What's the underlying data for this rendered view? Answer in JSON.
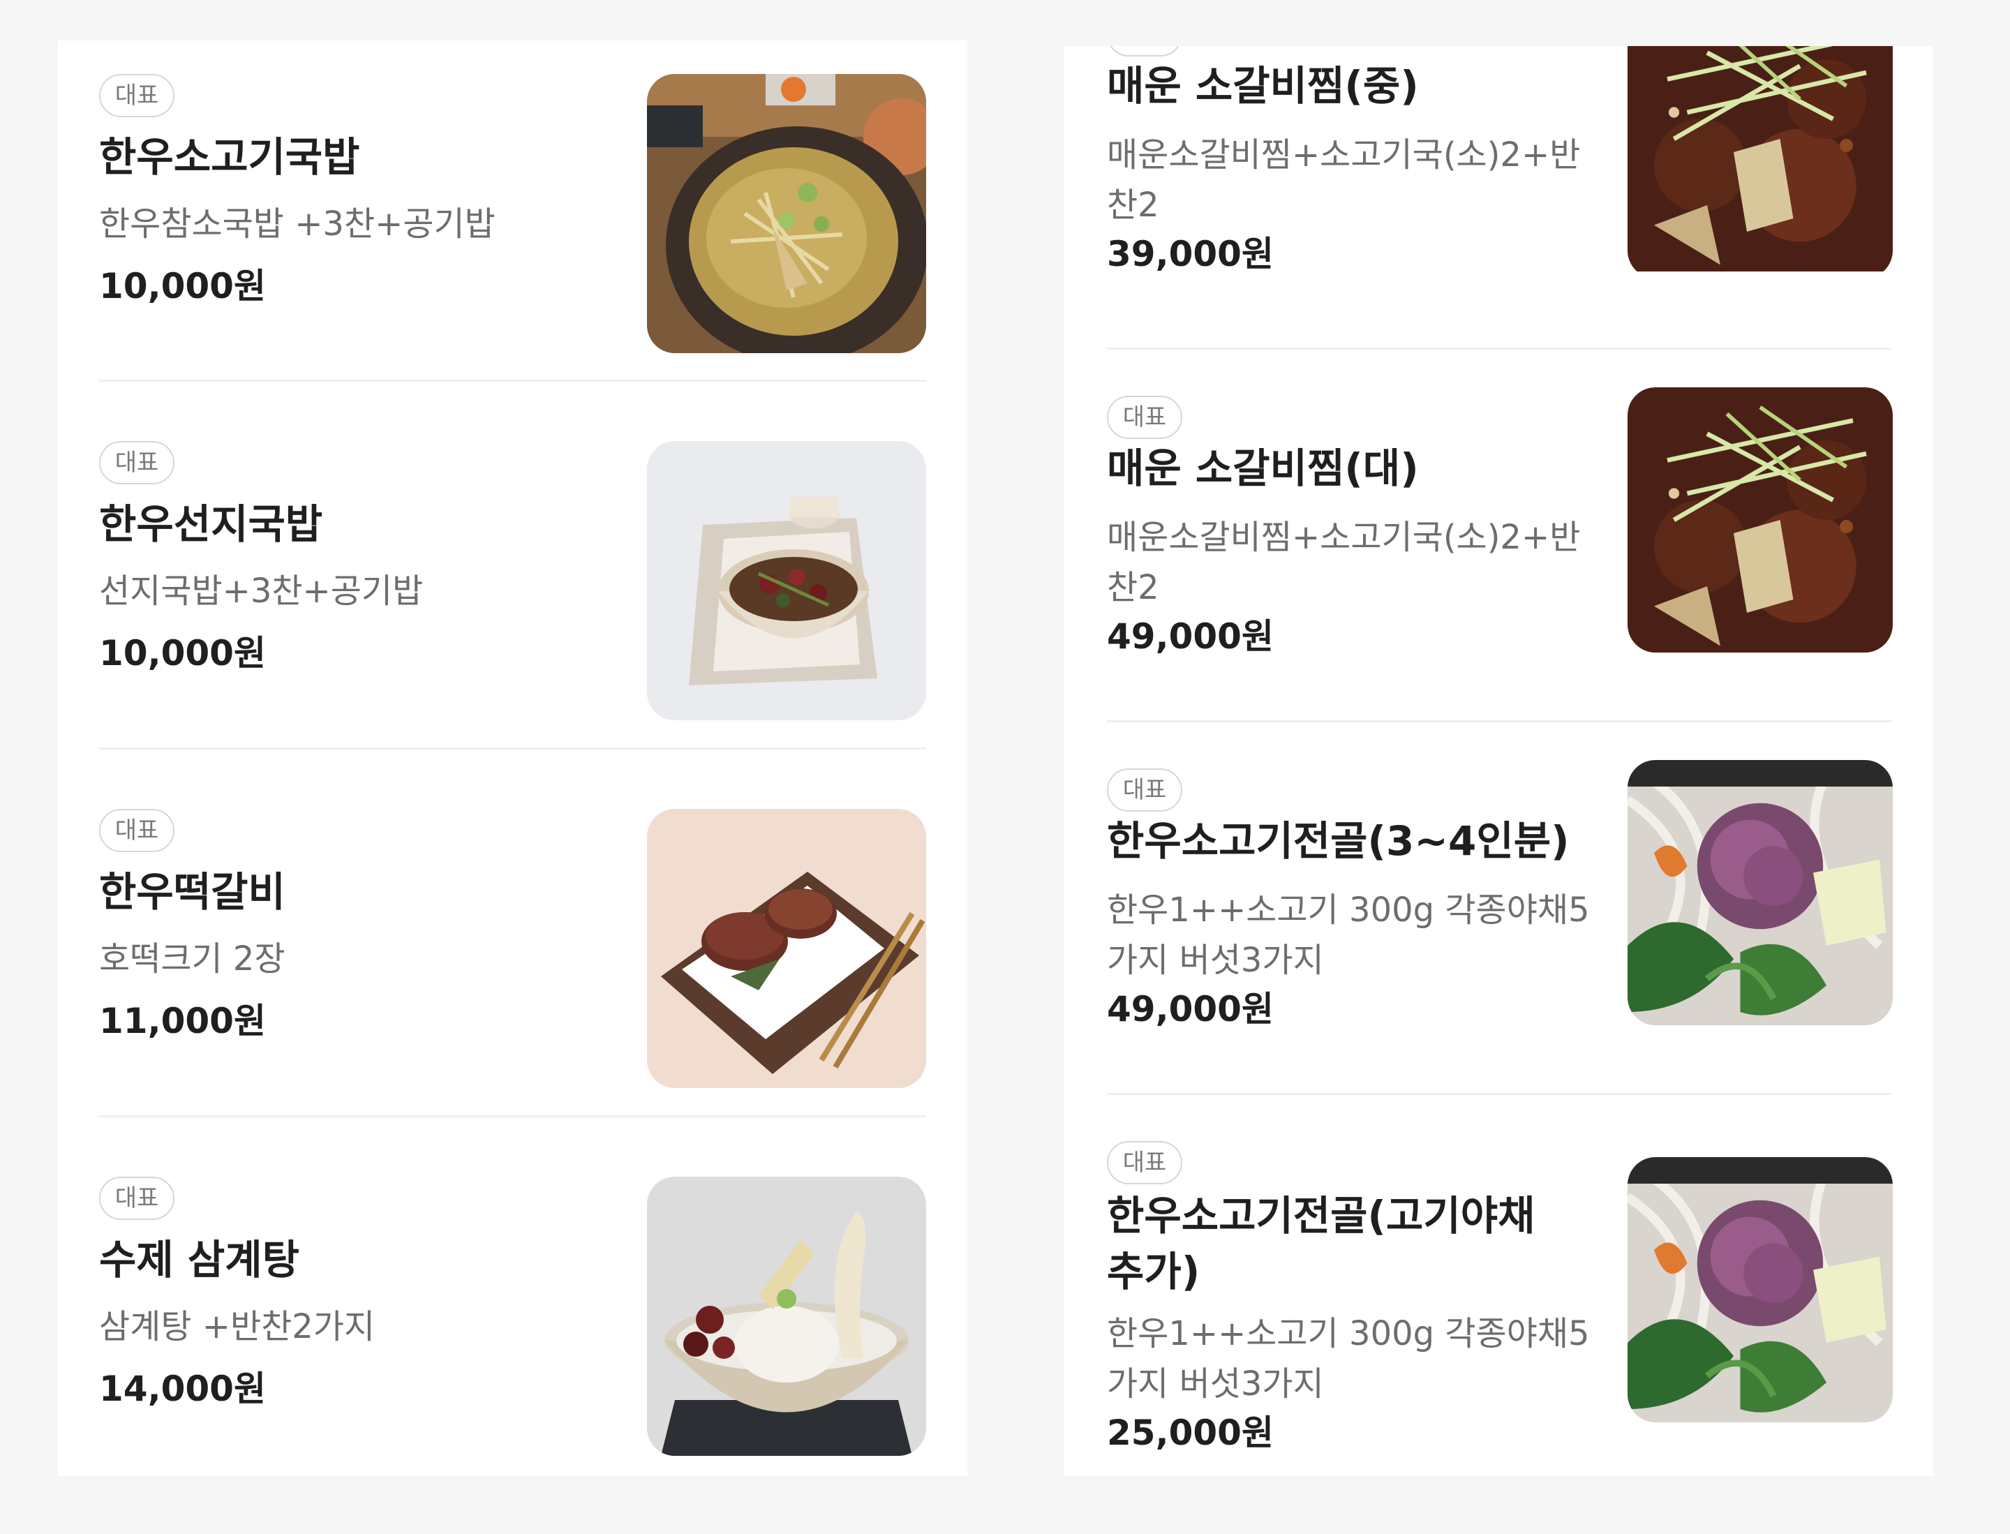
{
  "badge_label": "대표",
  "left_menu": [
    {
      "name": "한우소고기국밥",
      "description": "한우참소국밥 +3찬+공기밥",
      "price": "10,000원",
      "image": "beef-soup-rice-photo"
    },
    {
      "name": "한우선지국밥",
      "description": "선지국밥+3찬+공기밥",
      "price": "10,000원",
      "image": "blood-sausage-soup-photo"
    },
    {
      "name": "한우떡갈비",
      "description": "호떡크기 2장",
      "price": "11,000원",
      "image": "grilled-short-rib-patty-photo"
    },
    {
      "name": "수제 삼계탕",
      "description": "삼계탕 +반찬2가지",
      "price": "14,000원",
      "image": "ginseng-chicken-soup-photo"
    }
  ],
  "right_menu": [
    {
      "name": "매운 소갈비찜(중)",
      "description": "매운소갈비찜+소고기국(소)2+반찬2",
      "price": "39,000원",
      "image": "spicy-braised-short-ribs-photo"
    },
    {
      "name": "매운 소갈비찜(대)",
      "description": "매운소갈비찜+소고기국(소)2+반찬2",
      "price": "49,000원",
      "image": "spicy-braised-short-ribs-photo"
    },
    {
      "name": "한우소고기전골(3~4인분)",
      "description": "한우1++소고기 300g 각종야채5가지 버섯3가지",
      "price": "49,000원",
      "image": "beef-hot-pot-photo"
    },
    {
      "name": "한우소고기전골(고기야채추가)",
      "description": "한우1++소고기 300g 각종야채5가지 버섯3가지",
      "price": "25,000원",
      "image": "beef-hot-pot-photo"
    }
  ]
}
